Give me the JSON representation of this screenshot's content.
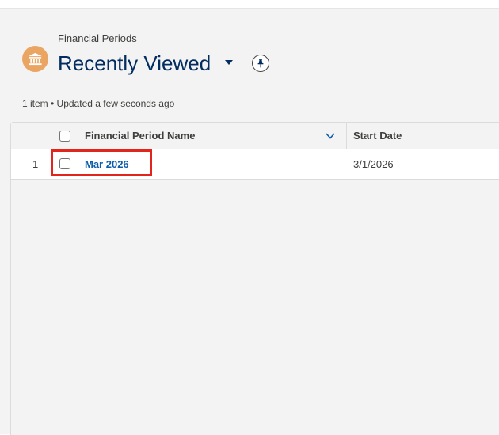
{
  "header": {
    "object_label": "Financial Periods",
    "list_title": "Recently Viewed",
    "object_icon": "bank-icon",
    "pin_icon": "pin-icon"
  },
  "list_meta": "1 item • Updated a few seconds ago",
  "table": {
    "columns": [
      "Financial Period Name",
      "Start Date"
    ],
    "rows": [
      {
        "number": "1",
        "name": "Mar 2026",
        "start_date": "3/1/2026"
      }
    ]
  },
  "colors": {
    "accent_link": "#0b5cab",
    "title": "#032d60",
    "icon_bg": "#eaa563",
    "highlight": "#e3241b"
  }
}
